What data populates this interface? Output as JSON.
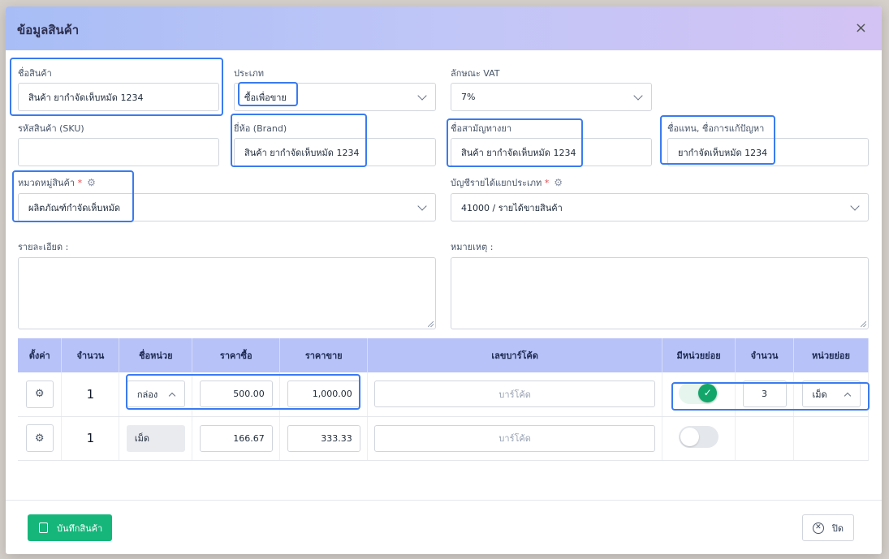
{
  "modal": {
    "title": "ข้อมูลสินค้า",
    "close_icon": "×"
  },
  "form": {
    "product_name": {
      "label": "ชื่อสินค้า",
      "value": "สินค้า ยากำจัดเห็บหมัด 1234"
    },
    "type": {
      "label": "ประเภท",
      "value": "ซื้อเพื่อขาย"
    },
    "vat": {
      "label": "ลักษณะ VAT",
      "value": "7%"
    },
    "sku": {
      "label": "รหัสสินค้า (SKU)",
      "value": ""
    },
    "brand": {
      "label": "ยี่ห้อ (Brand)",
      "value": "สินค้า ยากำจัดเห็บหมัด 1234"
    },
    "generic_name": {
      "label": "ชื่อสามัญทางยา",
      "value": "สินค้า ยากำจัดเห็บหมัด 1234"
    },
    "alias": {
      "label": "ชื่อแทน, ชื่อการแก้ปัญหา",
      "value": "ยากำจัดเห็บหมัด 1234"
    },
    "category": {
      "label": "หมวดหมู่สินค้า",
      "required": "*",
      "value": "ผลิตภัณฑ์กำจัดเห็บหมัด"
    },
    "revenue_account": {
      "label": "บัญชีรายได้แยกประเภท",
      "required": "*",
      "value": "41000 / รายได้ขายสินค้า"
    },
    "details": {
      "label": "รายละเอียด :"
    },
    "remarks": {
      "label": "หมายเหตุ :"
    }
  },
  "units_table": {
    "headers": [
      "ตั้งค่า",
      "จำนวน",
      "ชื่อหน่วย",
      "ราคาซื้อ",
      "ราคาขาย",
      "เลขบาร์โค้ด",
      "มีหน่วยย่อย",
      "จำนวน",
      "หน่วยย่อย"
    ],
    "rows": [
      {
        "qty": "1",
        "unit": "กล่อง",
        "buy": "500.00",
        "sell": "1,000.00",
        "barcode_placeholder": "บาร์โค้ด",
        "has_sub": true,
        "sub_qty": "3",
        "sub_unit": "เม็ด"
      },
      {
        "qty": "1",
        "unit": "เม็ด",
        "buy": "166.67",
        "sell": "333.33",
        "barcode_placeholder": "บาร์โค้ด",
        "has_sub": false,
        "sub_qty": "",
        "sub_unit": ""
      }
    ]
  },
  "footer": {
    "save_label": "บันทึกสินค้า",
    "close_label": "ปิด"
  },
  "colors": {
    "accent": "#16b67b",
    "highlight": "#3a7bef",
    "header": "#b7c2f8"
  }
}
